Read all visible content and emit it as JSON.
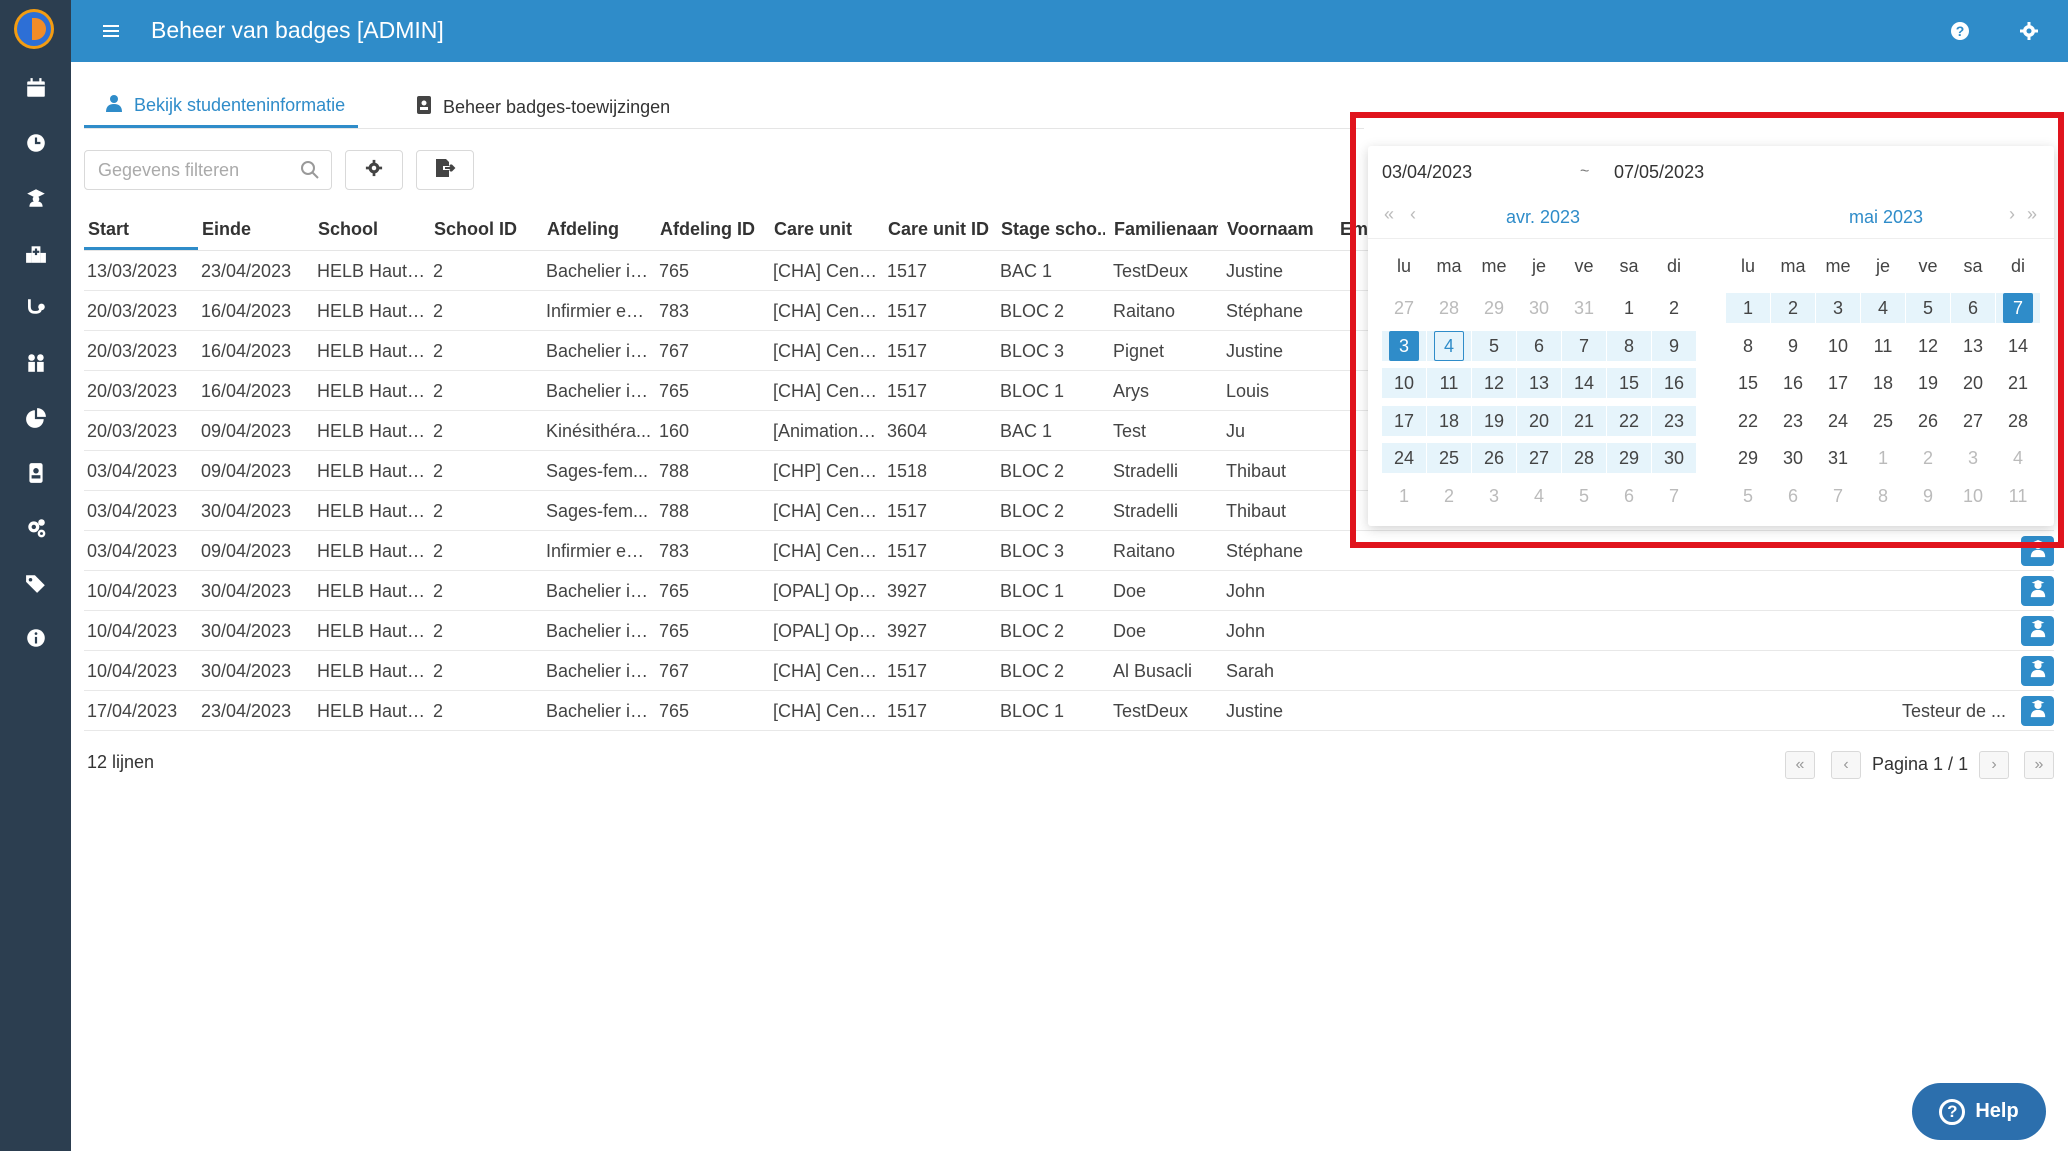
{
  "app": {
    "title": "Beheer van badges [ADMIN]"
  },
  "sidebar": {
    "items": [
      "calendar-icon",
      "clock-icon",
      "graduate-icon",
      "hospital-icon",
      "stethoscope-icon",
      "people-icon",
      "pie-chart-icon",
      "badge-icon",
      "gears-icon",
      "tags-icon",
      "info-icon"
    ]
  },
  "tabs": [
    {
      "label": "Bekijk studenteninformatie",
      "icon": "user-icon",
      "active": true
    },
    {
      "label": "Beheer badges-toewijzingen",
      "icon": "badge-icon",
      "active": false
    }
  ],
  "toolbar": {
    "filter_placeholder": "Gegevens filteren"
  },
  "table": {
    "columns": [
      "Start",
      "Einde",
      "School",
      "School ID",
      "Afdeling",
      "Afdeling ID",
      "Care unit",
      "Care unit ID",
      "Stage scho...",
      "Familienaam",
      "Voornaam",
      "Em"
    ],
    "rows": [
      [
        "13/03/2023",
        "23/04/2023",
        "HELB Haute...",
        "2",
        "Bachelier in...",
        "765",
        "[CHA] Centr...",
        "1517",
        "BAC 1",
        "TestDeux",
        "Justine",
        ""
      ],
      [
        "20/03/2023",
        "16/04/2023",
        "HELB Haute...",
        "2",
        "Infirmier en ...",
        "783",
        "[CHA] Centr...",
        "1517",
        "BLOC 2",
        "Raitano",
        "Stéphane",
        ""
      ],
      [
        "20/03/2023",
        "16/04/2023",
        "HELB Haute...",
        "2",
        "Bachelier in...",
        "767",
        "[CHA] Centr...",
        "1517",
        "BLOC 3",
        "Pignet",
        "Justine",
        ""
      ],
      [
        "20/03/2023",
        "16/04/2023",
        "HELB Haute...",
        "2",
        "Bachelier in...",
        "765",
        "[CHA] Centr...",
        "1517",
        "BLOC 1",
        "Arys",
        "Louis",
        ""
      ],
      [
        "20/03/2023",
        "09/04/2023",
        "HELB Haute...",
        "2",
        "Kinésithéra...",
        "160",
        "[Animation] ...",
        "3604",
        "BAC 1",
        "Test",
        "Ju",
        ""
      ],
      [
        "03/04/2023",
        "09/04/2023",
        "HELB Haute...",
        "2",
        "Sages-fem...",
        "788",
        "[CHP] Centr...",
        "1518",
        "BLOC 2",
        "Stradelli",
        "Thibaut",
        ""
      ],
      [
        "03/04/2023",
        "30/04/2023",
        "HELB Haute...",
        "2",
        "Sages-fem...",
        "788",
        "[CHA] Centr...",
        "1517",
        "BLOC 2",
        "Stradelli",
        "Thibaut",
        ""
      ],
      [
        "03/04/2023",
        "09/04/2023",
        "HELB Haute...",
        "2",
        "Infirmier en ...",
        "783",
        "[CHA] Centr...",
        "1517",
        "BLOC 3",
        "Raitano",
        "Stéphane",
        ""
      ],
      [
        "10/04/2023",
        "30/04/2023",
        "HELB Haute...",
        "2",
        "Bachelier in...",
        "765",
        "[OPAL] Opal...",
        "3927",
        "BLOC 1",
        "Doe",
        "John",
        ""
      ],
      [
        "10/04/2023",
        "30/04/2023",
        "HELB Haute...",
        "2",
        "Bachelier in...",
        "765",
        "[OPAL] Opal...",
        "3927",
        "BLOC 2",
        "Doe",
        "John",
        ""
      ],
      [
        "10/04/2023",
        "30/04/2023",
        "HELB Haute...",
        "2",
        "Bachelier in...",
        "767",
        "[CHA] Centr...",
        "1517",
        "BLOC 2",
        "Al Busacli",
        "Sarah",
        ""
      ],
      [
        "17/04/2023",
        "23/04/2023",
        "HELB Haute...",
        "2",
        "Bachelier in...",
        "765",
        "[CHA] Centr...",
        "1517",
        "BLOC 1",
        "TestDeux",
        "Justine",
        "Testeur de ..."
      ]
    ]
  },
  "footer": {
    "count": "12 lijnen",
    "page": "Pagina 1 / 1"
  },
  "picker": {
    "start": "03/04/2023",
    "separator": "~",
    "end": "07/05/2023",
    "weekdays": [
      "lu",
      "ma",
      "me",
      "je",
      "ve",
      "sa",
      "di"
    ],
    "months": [
      {
        "title": "avr. 2023",
        "days": [
          "27",
          "28",
          "29",
          "30",
          "31",
          "1",
          "2",
          "3",
          "4",
          "5",
          "6",
          "7",
          "8",
          "9",
          "10",
          "11",
          "12",
          "13",
          "14",
          "15",
          "16",
          "17",
          "18",
          "19",
          "20",
          "21",
          "22",
          "23",
          "24",
          "25",
          "26",
          "27",
          "28",
          "29",
          "30",
          "1",
          "2",
          "3",
          "4",
          "5",
          "6",
          "7"
        ],
        "first_in": 5,
        "last_in": 34,
        "range_from": 7,
        "range_to": 34,
        "selected": 7,
        "today": 8
      },
      {
        "title": "mai 2023",
        "days": [
          "1",
          "2",
          "3",
          "4",
          "5",
          "6",
          "7",
          "8",
          "9",
          "10",
          "11",
          "12",
          "13",
          "14",
          "15",
          "16",
          "17",
          "18",
          "19",
          "20",
          "21",
          "22",
          "23",
          "24",
          "25",
          "26",
          "27",
          "28",
          "29",
          "30",
          "31",
          "1",
          "2",
          "3",
          "4",
          "5",
          "6",
          "7",
          "8",
          "9",
          "10",
          "11"
        ],
        "first_in": 0,
        "last_in": 30,
        "range_from": 0,
        "range_to": 6,
        "selected": 6,
        "today": -1
      }
    ]
  },
  "help": {
    "label": "Help"
  },
  "colors": {
    "primary": "#2f8cc9",
    "sidebar": "#2c3e50",
    "highlight": "#e0141d"
  }
}
